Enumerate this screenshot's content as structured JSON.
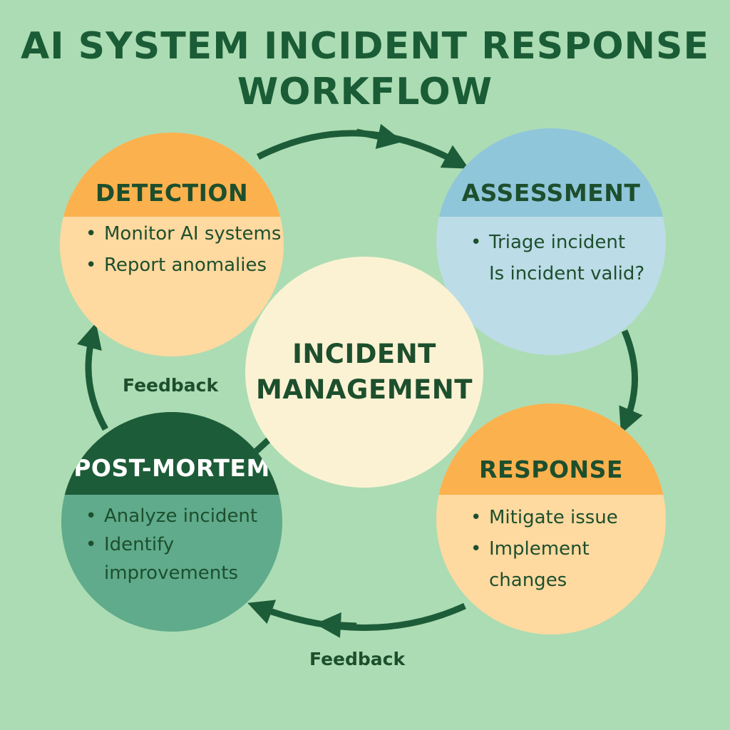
{
  "title": {
    "line1": "AI SYSTEM INCIDENT RESPONSE",
    "line2": "WORKFLOW"
  },
  "center": {
    "line1": "INCIDENT",
    "line2": "MANAGEMENT"
  },
  "stages": {
    "detection": {
      "heading": "DETECTION",
      "items": [
        "Monitor AI systems",
        "Report anomalies"
      ]
    },
    "assessment": {
      "heading": "ASSESSMENT",
      "items": [
        "Triage incident",
        "Is incident valid?"
      ]
    },
    "response": {
      "heading": "RESPONSE",
      "items": [
        "Mitigate issue",
        "Implement changes"
      ]
    },
    "postmortem": {
      "heading": "POST-MORTEM",
      "items": [
        "Analyze incident",
        "Identify",
        "improvements"
      ]
    }
  },
  "feedback": {
    "left": "Feedback",
    "bottom": "Feedback"
  },
  "colors": {
    "background": "#acdcb3",
    "title": "#1a5c35",
    "arrow": "#1d5c38",
    "orange_band": "#fbb14e",
    "orange_body": "#fed9a0",
    "blue_band": "#8fc6da",
    "blue_body": "#bcdce7",
    "green_band": "#1d5c38",
    "green_body": "#5fab8b",
    "center": "#fbf2d4"
  }
}
